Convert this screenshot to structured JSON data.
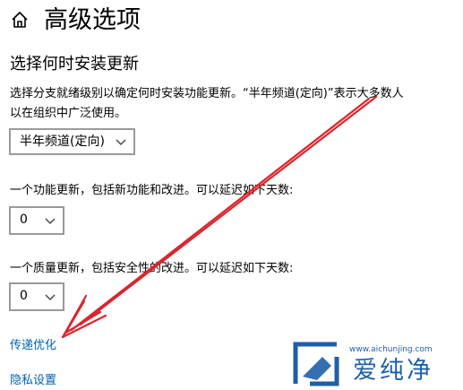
{
  "header": {
    "title": "高级选项"
  },
  "updates": {
    "heading": "选择何时安装更新",
    "description_line1": "选择分支就绪级别以确定何时安装功能更新。“半年频道(定向)”表示大多数人",
    "description_line2": "以在组织中广泛使用。",
    "branch_select_value": "半年频道(定向)",
    "feature_label": "一个功能更新，包括新功能和改进。可以延迟如下天数:",
    "feature_defer_value": "0",
    "quality_label": "一个质量更新，包括安全性的改进。可以延迟如下天数:",
    "quality_defer_value": "0"
  },
  "links": {
    "delivery_optimization": "传递优化",
    "privacy_settings": "隐私设置"
  },
  "watermark": {
    "url": "www.aichunjing.com",
    "text": "爱纯净"
  },
  "colors": {
    "link": "#0063b1",
    "annotation_arrow": "#d9262e",
    "watermark": "#1f5fa8"
  },
  "icons": {
    "home": "home-icon",
    "chevron": "chevron-down-icon"
  }
}
